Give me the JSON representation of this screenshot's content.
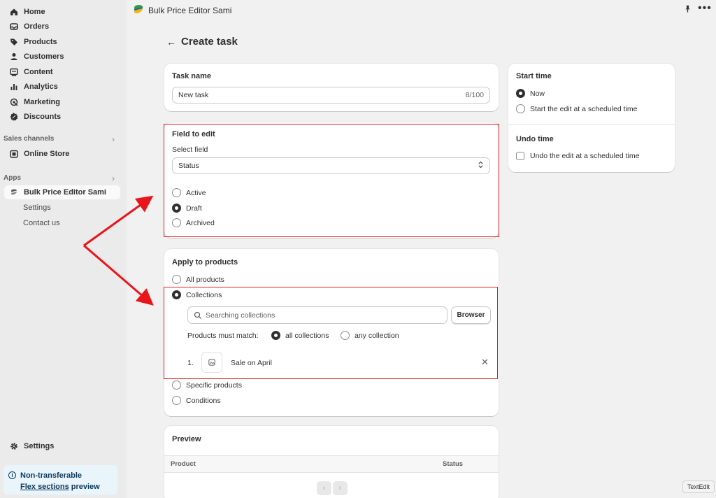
{
  "sidebar": {
    "items": [
      {
        "label": "Home",
        "icon": "home-icon"
      },
      {
        "label": "Orders",
        "icon": "inbox-icon"
      },
      {
        "label": "Products",
        "icon": "tag-icon"
      },
      {
        "label": "Customers",
        "icon": "person-icon"
      },
      {
        "label": "Content",
        "icon": "content-icon"
      },
      {
        "label": "Analytics",
        "icon": "bar-chart-icon"
      },
      {
        "label": "Marketing",
        "icon": "target-icon"
      },
      {
        "label": "Discounts",
        "icon": "discount-icon"
      }
    ],
    "sales_channels_label": "Sales channels",
    "online_store": "Online Store",
    "apps_label": "Apps",
    "app_name": "Bulk Price Editor Sami",
    "app_sub": [
      "Settings",
      "Contact us"
    ],
    "settings": "Settings",
    "promo_line1": "Non-transferable",
    "promo_link": "Flex sections",
    "promo_after": " preview"
  },
  "topbar": {
    "title": "Bulk Price Editor Sami",
    "more": "•••"
  },
  "page": {
    "back": "←",
    "title": "Create task"
  },
  "task_name": {
    "title": "Task name",
    "value": "New task",
    "count": "8/100"
  },
  "field_to_edit": {
    "title": "Field to edit",
    "select_label": "Select field",
    "select_value": "Status",
    "options": [
      {
        "label": "Active",
        "selected": false
      },
      {
        "label": "Draft",
        "selected": true
      },
      {
        "label": "Archived",
        "selected": false
      }
    ]
  },
  "apply": {
    "title": "Apply to products",
    "all_products": "All products",
    "collections": "Collections",
    "search_placeholder": "Searching collections",
    "browse_button": "Browser",
    "match_label": "Products must match:",
    "match_all": "all collections",
    "match_any": "any collection",
    "collection_index": "1.",
    "collection_name": "Sale on April",
    "specific_products": "Specific products",
    "conditions": "Conditions"
  },
  "start_time": {
    "title": "Start time",
    "now": "Now",
    "scheduled": "Start the edit at a scheduled time"
  },
  "undo_time": {
    "title": "Undo time",
    "scheduled": "Undo the edit at a scheduled time"
  },
  "preview": {
    "title": "Preview",
    "col_product": "Product",
    "col_status": "Status"
  },
  "tooltip": "TextEdit",
  "colors": {
    "highlight": "#d92026",
    "accent": "#303030"
  }
}
